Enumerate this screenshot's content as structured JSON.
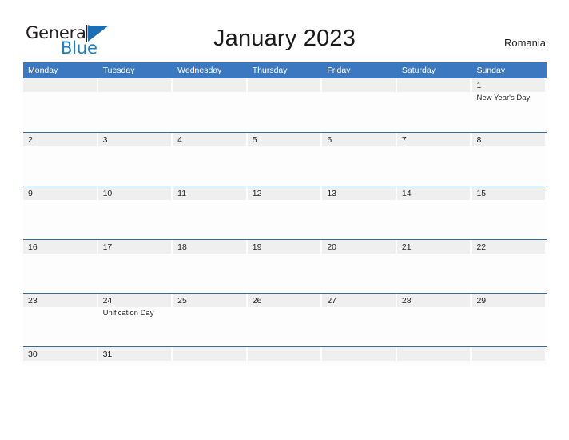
{
  "brand": {
    "name_part1": "General",
    "name_part2": "Blue",
    "flag_icon": "flag-triangle-icon",
    "accent_color": "#1e7fc4"
  },
  "header": {
    "title": "January 2023",
    "country": "Romania"
  },
  "colors": {
    "header_blue": "#3b78bf",
    "row_divider_blue": "#2f6cae",
    "date_band_gray": "#efefef",
    "text_dark": "#231f20"
  },
  "calendar": {
    "weekdays": [
      "Monday",
      "Tuesday",
      "Wednesday",
      "Thursday",
      "Friday",
      "Saturday",
      "Sunday"
    ],
    "weeks": [
      [
        {
          "date": "",
          "events": []
        },
        {
          "date": "",
          "events": []
        },
        {
          "date": "",
          "events": []
        },
        {
          "date": "",
          "events": []
        },
        {
          "date": "",
          "events": []
        },
        {
          "date": "",
          "events": []
        },
        {
          "date": "1",
          "events": [
            "New Year's Day"
          ]
        }
      ],
      [
        {
          "date": "2",
          "events": []
        },
        {
          "date": "3",
          "events": []
        },
        {
          "date": "4",
          "events": []
        },
        {
          "date": "5",
          "events": []
        },
        {
          "date": "6",
          "events": []
        },
        {
          "date": "7",
          "events": []
        },
        {
          "date": "8",
          "events": []
        }
      ],
      [
        {
          "date": "9",
          "events": []
        },
        {
          "date": "10",
          "events": []
        },
        {
          "date": "11",
          "events": []
        },
        {
          "date": "12",
          "events": []
        },
        {
          "date": "13",
          "events": []
        },
        {
          "date": "14",
          "events": []
        },
        {
          "date": "15",
          "events": []
        }
      ],
      [
        {
          "date": "16",
          "events": []
        },
        {
          "date": "17",
          "events": []
        },
        {
          "date": "18",
          "events": []
        },
        {
          "date": "19",
          "events": []
        },
        {
          "date": "20",
          "events": []
        },
        {
          "date": "21",
          "events": []
        },
        {
          "date": "22",
          "events": []
        }
      ],
      [
        {
          "date": "23",
          "events": []
        },
        {
          "date": "24",
          "events": [
            "Unification Day"
          ]
        },
        {
          "date": "25",
          "events": []
        },
        {
          "date": "26",
          "events": []
        },
        {
          "date": "27",
          "events": []
        },
        {
          "date": "28",
          "events": []
        },
        {
          "date": "29",
          "events": []
        }
      ],
      [
        {
          "date": "30",
          "events": []
        },
        {
          "date": "31",
          "events": []
        },
        {
          "date": "",
          "events": []
        },
        {
          "date": "",
          "events": []
        },
        {
          "date": "",
          "events": []
        },
        {
          "date": "",
          "events": []
        },
        {
          "date": "",
          "events": []
        }
      ]
    ]
  }
}
